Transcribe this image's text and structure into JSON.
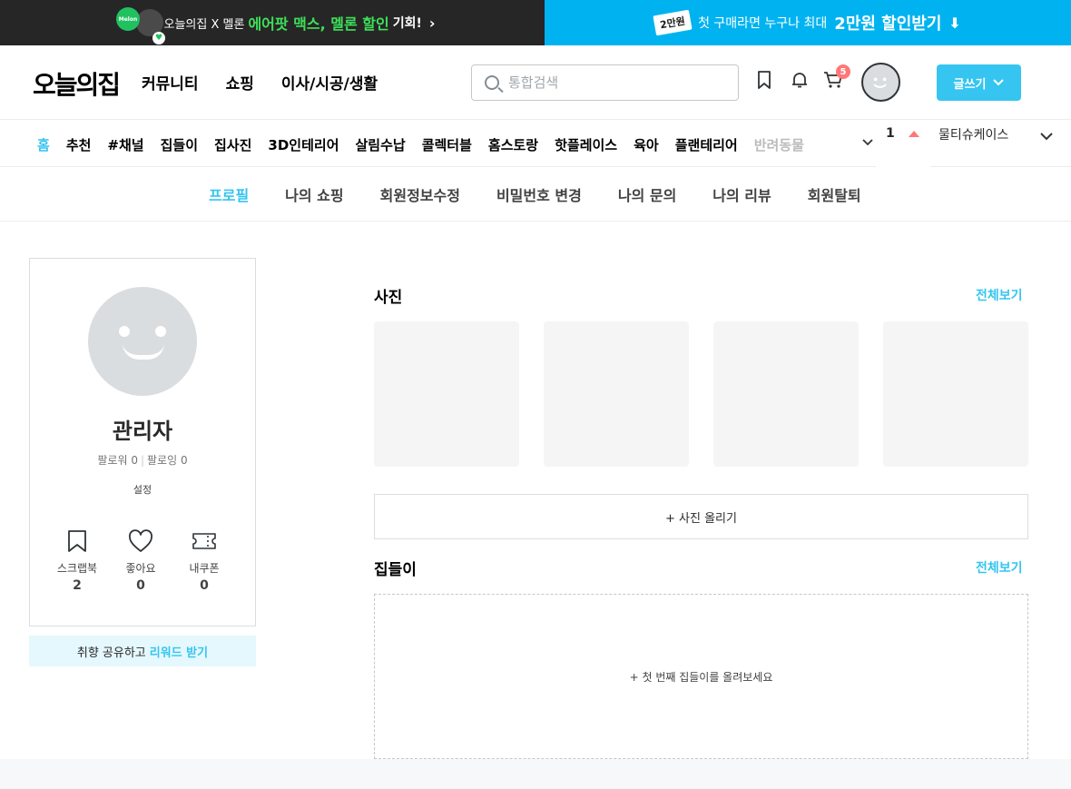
{
  "banner_left": {
    "logo_text": "Melon",
    "lead": "오늘의집 X 멜론",
    "highlight": "에어팟 맥스, 멜론 할인",
    "tail": "기회!"
  },
  "banner_right": {
    "coupon": "2만원",
    "lead": "첫 구매라면 누구나 최대",
    "highlight": "2만원 할인받기"
  },
  "header": {
    "brand": "오늘의집",
    "gnb": [
      "커뮤니티",
      "쇼핑",
      "이사/시공/생활"
    ],
    "search_placeholder": "통합검색",
    "cart_count": "5",
    "write_label": "글쓰기"
  },
  "categories": [
    "홈",
    "추천",
    "#채널",
    "집들이",
    "집사진",
    "3D인테리어",
    "살림수납",
    "콜렉터블",
    "홈스토랑",
    "핫플레이스",
    "육아",
    "플랜테리어",
    "반려동물"
  ],
  "trending": {
    "rank": "1",
    "word": "물티슈케이스"
  },
  "subnav": [
    "프로필",
    "나의 쇼핑",
    "회원정보수정",
    "비밀번호 변경",
    "나의 문의",
    "나의 리뷰",
    "회원탈퇴"
  ],
  "profile": {
    "name": "관리자",
    "followers": "팔로워 0",
    "following": "팔로잉 0",
    "settings": "설정",
    "stats": [
      {
        "label": "스크랩북",
        "value": "2",
        "icon": "bookmark-icon"
      },
      {
        "label": "좋아요",
        "value": "0",
        "icon": "heart-icon"
      },
      {
        "label": "내쿠폰",
        "value": "0",
        "icon": "coupon-icon"
      }
    ],
    "reward_lead": "취향 공유하고",
    "reward_highlight": "리워드 받기"
  },
  "photos": {
    "title": "사진",
    "see_all": "전체보기",
    "upload_label": "+ 사진 올리기"
  },
  "housewarming": {
    "title": "집들이",
    "see_all": "전체보기",
    "empty_cta": "+ 첫 번째 집들이를 올려보세요"
  },
  "colors": {
    "accent": "#35c5f0",
    "banner_dark": "#262626",
    "banner_blue": "#00b3f0",
    "badge_red": "#ff7777"
  }
}
